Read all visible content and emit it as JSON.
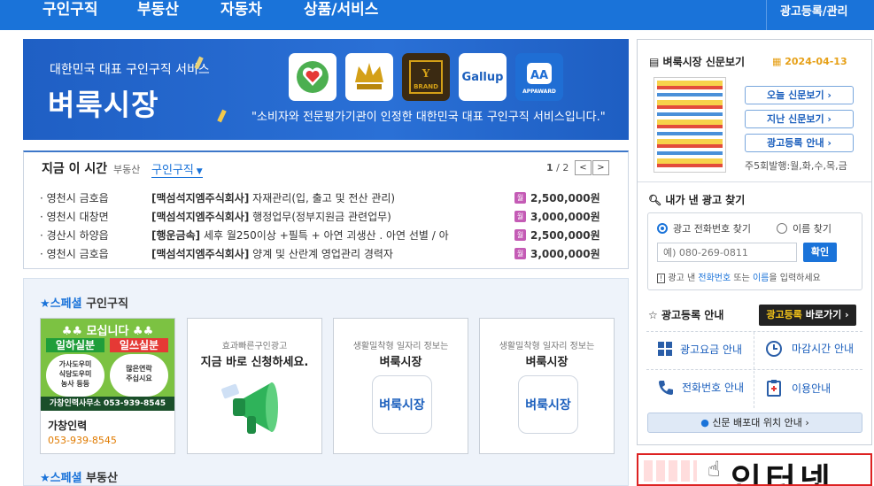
{
  "nav": {
    "items": [
      "구인구직",
      "부동산",
      "자동차",
      "상품/서비스"
    ],
    "ad_link": "광고등록/관리"
  },
  "banner": {
    "subtitle": "대한민국 대표 구인구직 서비스",
    "title": "벼룩시장",
    "slogan": "\"소비자와 전문평가기관이 인정한 대한민국 대표 구인구직 서비스입니다.\"",
    "badges": [
      "소비자웰빙",
      "KOREA",
      "BRAND",
      "Gallup",
      "APPAWARD"
    ]
  },
  "now": {
    "title": "지금 이 시간",
    "cat_realestate": "부동산",
    "cat_jobs": "구인구직",
    "page_current": "1",
    "page_total": "/ 2",
    "prev": "<",
    "next": ">",
    "rows": [
      {
        "loc": "· 영천시 금호읍",
        "company": "[맥섬석지엠주식회사]",
        "desc": " 자재관리(입, 출고 및 전산 관리)",
        "pay": "2,500,000원"
      },
      {
        "loc": "· 영천시 대창면",
        "company": "[맥섬석지엠주식회사]",
        "desc": " 행정업무(정부지원금 관련업무)",
        "pay": "3,000,000원"
      },
      {
        "loc": "· 경산시 하양읍",
        "company": "[행운금속]",
        "desc": " 세후 월250이상 +필특 + 아연 괴생산 . 아연 선별 / 아",
        "pay": "2,500,000원"
      },
      {
        "loc": "· 영천시 금호읍",
        "company": "[맥섬석지엠주식회사]",
        "desc": " 양계 및 산란계 영업관리 경력자",
        "pay": "3,000,000원"
      }
    ],
    "wage_icon": "월"
  },
  "special": {
    "label": "스페셜",
    "jobs": "구인구직",
    "realestate": "부동산",
    "ad_card": {
      "header": "♣♣ 모십니다 ♣♣",
      "tag1": "일하실분",
      "tag2": "일쓰실분",
      "body1": "가사도우미\n식당도우미\n농사 등등",
      "body2": "많은연락\n주십시요",
      "phone_line": "가창인력사무소 053-939-8545",
      "name": "가창인력",
      "phone": "053-939-8545"
    },
    "card2": {
      "small": "효과빠른구인광고",
      "main": "지금 바로 신청하세요."
    },
    "card3": {
      "small": "생활밀착형 일자리 정보는",
      "main": "벼룩시장",
      "logo": "벼룩시장"
    },
    "card4": {
      "small": "생활밀착형 일자리 정보는",
      "main": "벼룩시장",
      "logo": "벼룩시장"
    }
  },
  "paper": {
    "title": "벼룩시장 신문보기",
    "date": "2024-04-13",
    "btn_today": "오늘 신문보기 ›",
    "btn_past": "지난 신문보기 ›",
    "btn_ad": "광고등록 안내 ›",
    "issue": "주5회발행:월,화,수,목,금"
  },
  "find": {
    "title": "내가 낸 광고 찾기",
    "opt_phone": "광고 전화번호 찾기",
    "opt_name": "이름 찾기",
    "placeholder": "예) 080-269-0811",
    "confirm": "확인",
    "hint_pre": "광고 낸 ",
    "hint_phone": "전화번호",
    "hint_mid": " 또는 ",
    "hint_name": "이름",
    "hint_post": "을 입력하세요"
  },
  "adinfo": {
    "title": "광고등록 안내",
    "shortcut": "광고등록 바로가기 ›",
    "shortcut_hl": "광고등록",
    "items": [
      "광고요금 안내",
      "마감시간 안내",
      "전화번호 안내",
      "이용안내"
    ],
    "location": "신문 배포대 위치 안내 ›"
  },
  "bottom_ad": {
    "text": "인터넷"
  },
  "colors": {
    "brand": "#1a73d9",
    "accent": "#f5a623",
    "pay_icon": "#c45bb5"
  }
}
